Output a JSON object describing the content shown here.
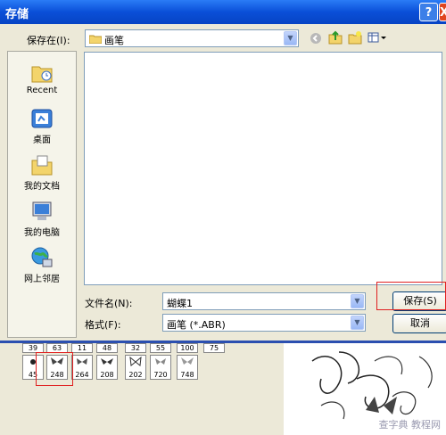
{
  "dialog": {
    "title": "存储",
    "help_label": "?",
    "close_label": "X",
    "save_in_label": "保存在(I):",
    "save_in_value": "画笔",
    "toolbar_icons": [
      "back-icon",
      "up-folder-icon",
      "new-folder-icon",
      "view-menu-icon"
    ],
    "places": [
      {
        "label": "Recent",
        "icon": "recent-folder-icon"
      },
      {
        "label": "桌面",
        "icon": "desktop-icon"
      },
      {
        "label": "我的文档",
        "icon": "my-documents-icon"
      },
      {
        "label": "我的电脑",
        "icon": "my-computer-icon"
      },
      {
        "label": "网上邻居",
        "icon": "network-icon"
      }
    ],
    "filename_label": "文件名(N):",
    "filename_value": "蝴蝶1",
    "format_label": "格式(F):",
    "format_value": "画笔 (*.ABR)",
    "save_button": "保存(S)",
    "cancel_button": "取消",
    "highlight_color": "#e02020"
  },
  "brush_palette": {
    "top_row": [
      "39",
      "63",
      "11",
      "48",
      "32",
      "55",
      "100",
      "75"
    ],
    "bottom_row": [
      "45",
      "248",
      "264",
      "208",
      "202",
      "720",
      "748"
    ],
    "selected": "248"
  },
  "watermark": "查字典 教程网"
}
